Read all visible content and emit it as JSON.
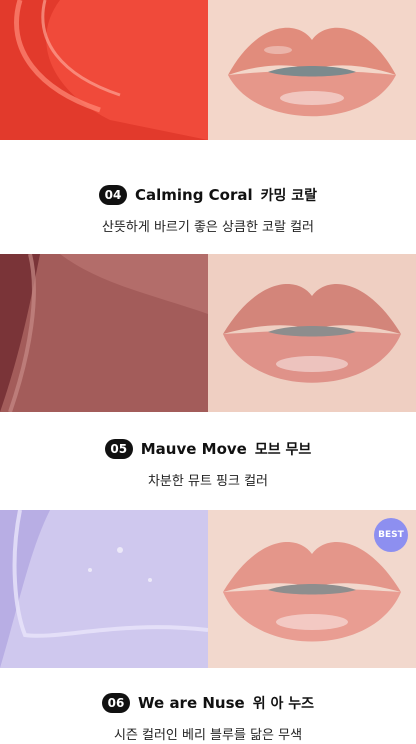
{
  "products": [
    {
      "num": "04",
      "name": "Calming Coral",
      "korean_name": "카밍 코랄",
      "description": "산뜻하게 바르기 좋은 상큼한 코랄 컬러",
      "swatch_color": "#f0503f",
      "lip_color": "#e39283",
      "badge": ""
    },
    {
      "num": "05",
      "name": "Mauve Move",
      "korean_name": "모브 무브",
      "description": "차분한 뮤트 핑크 컬러",
      "swatch_color": "#a8605e",
      "lip_color": "#d5867a",
      "badge": ""
    },
    {
      "num": "06",
      "name": "We are Nuse",
      "korean_name": "위 아 누즈",
      "description": "시즌 컬러인 베리 블루를 닮은 무색",
      "swatch_color": "#c9c2ea",
      "lip_color": "#e6958a",
      "badge": "BEST"
    }
  ]
}
